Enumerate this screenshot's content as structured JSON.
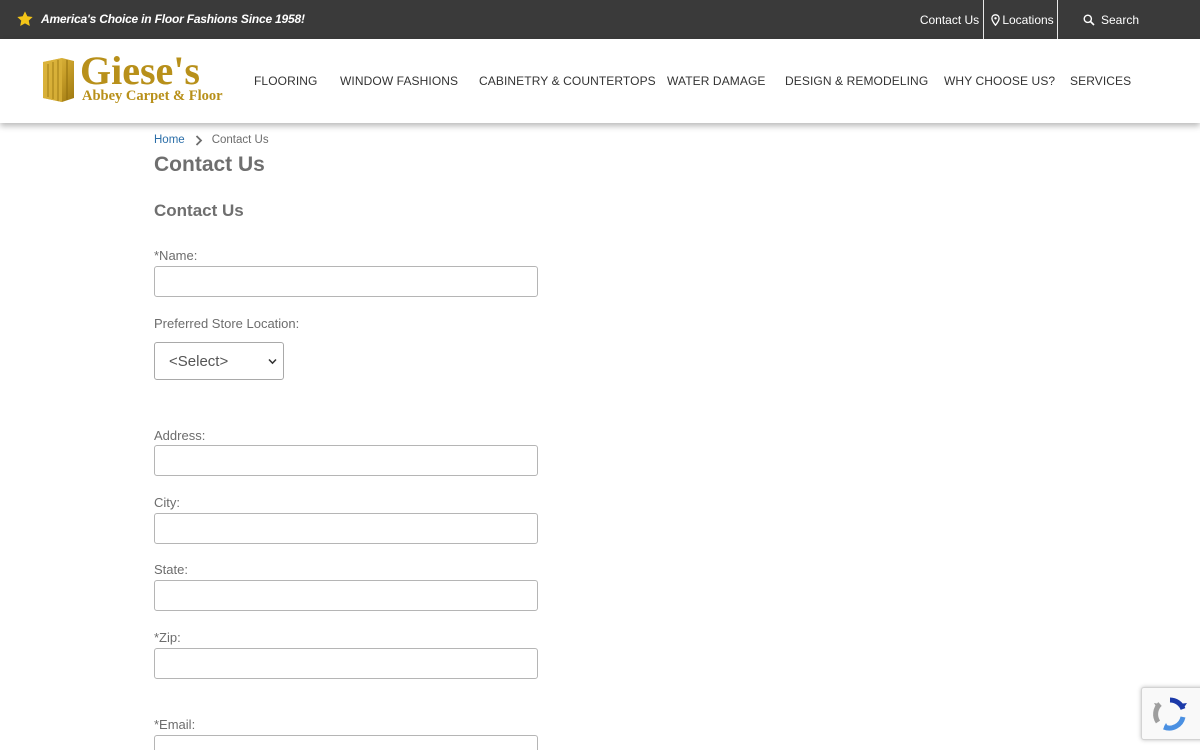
{
  "topbar": {
    "tagline": "America's Choice in Floor Fashions Since 1958!",
    "contact": "Contact Us",
    "locations": "Locations",
    "search": "Search"
  },
  "logo": {
    "title": "Giese's",
    "subtitle": "Abbey Carpet & Floor"
  },
  "nav": {
    "items": [
      "FLOORING",
      "WINDOW FASHIONS",
      "CABINETRY & COUNTERTOPS",
      "WATER DAMAGE",
      "DESIGN & REMODELING",
      "WHY CHOOSE US?",
      "SERVICES"
    ]
  },
  "breadcrumb": {
    "home": "Home",
    "current": "Contact Us"
  },
  "page": {
    "title": "Contact Us",
    "form_title": "Contact Us"
  },
  "form": {
    "name_label": "*Name:",
    "store_label": "Preferred Store Location:",
    "store_selected": "<Select>",
    "address_label": "Address:",
    "city_label": "City:",
    "state_label": "State:",
    "zip_label": "*Zip:",
    "email_label": "*Email:"
  },
  "colors": {
    "topbar_bg": "#3a3a3a",
    "star": "#f3c518",
    "logo_gold": "#b8901a",
    "link_blue": "#2b6ea8"
  }
}
